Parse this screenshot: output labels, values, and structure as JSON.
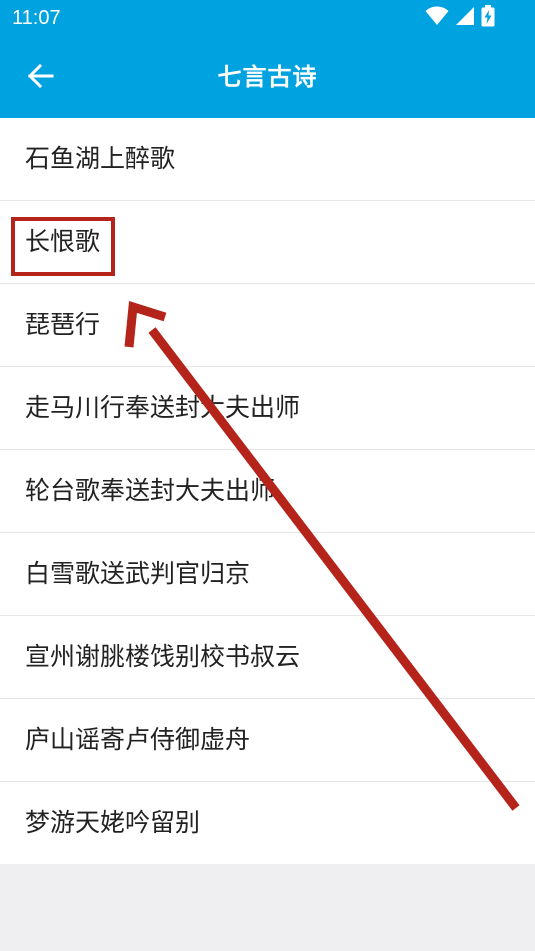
{
  "status_bar": {
    "time": "11:07",
    "icons": [
      "wifi-icon",
      "cell-signal-icon",
      "battery-charging-icon"
    ]
  },
  "app_bar": {
    "title": "七言古诗",
    "back_icon": "arrow-left-icon"
  },
  "poems": [
    {
      "label": "石鱼湖上醉歌"
    },
    {
      "label": "长恨歌"
    },
    {
      "label": "琵琶行"
    },
    {
      "label": "走马川行奉送封大夫出师"
    },
    {
      "label": "轮台歌奉送封大夫出师"
    },
    {
      "label": "白雪歌送武判官归京"
    },
    {
      "label": "宣州谢朓楼饯别校书叔云"
    },
    {
      "label": "庐山谣寄卢侍御虚舟"
    },
    {
      "label": "梦游天姥吟留别"
    }
  ],
  "colors": {
    "primary": "#00a2e0",
    "annotation": "#b5241b",
    "background": "#efeff1"
  }
}
